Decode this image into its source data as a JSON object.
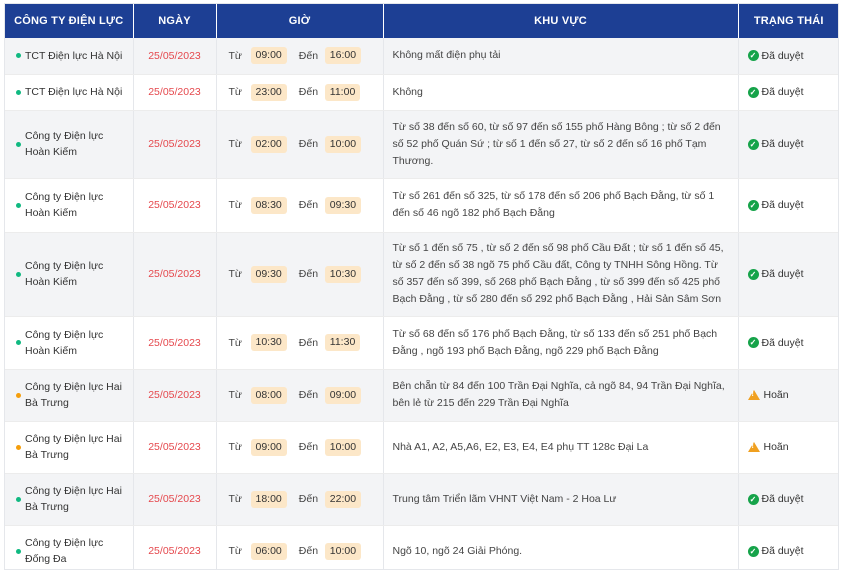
{
  "headers": [
    "CÔNG TY ĐIỆN LỰC",
    "NGÀY",
    "GIỜ",
    "KHU VỰC",
    "TRẠNG THÁI"
  ],
  "labels": {
    "from": "Từ",
    "to": "Đến"
  },
  "colors": {
    "header_bg": "#1d3f94",
    "date": "#e5484d",
    "dot_green": "#10b981",
    "dot_orange": "#f59e0b",
    "chip_bg": "#fce7c8"
  },
  "rows": [
    {
      "unit": "TCT Điện lực Hà Nội",
      "dot": "green",
      "date": "25/05/2023",
      "from": "09:00",
      "to": "16:00",
      "area": "Không mất điện phụ tải",
      "status": "Đã duyệt",
      "status_icon": "check-circle-icon",
      "h": 36
    },
    {
      "unit": "TCT Điện lực Hà Nội",
      "dot": "green",
      "date": "25/05/2023",
      "from": "23:00",
      "to": "11:00",
      "area": "Không",
      "status": "Đã duyệt",
      "status_icon": "check-circle-icon",
      "h": 36
    },
    {
      "unit": "Công ty Điện lực Hoàn Kiếm",
      "dot": "green",
      "date": "25/05/2023",
      "from": "02:00",
      "to": "10:00",
      "area": "Từ số 38 đến số 60, từ số 97 đến số 155 phố Hàng Bông ; từ số 2 đến số 52 phố Quán Sứ ; từ số 1 đến số 27, từ số 2 đến số 16 phố Tạm Thương.",
      "status": "Đã duyệt",
      "status_icon": "check-circle-icon",
      "h": 68
    },
    {
      "unit": "Công ty Điện lực Hoàn Kiếm",
      "dot": "green",
      "date": "25/05/2023",
      "from": "08:30",
      "to": "09:30",
      "area": "Từ số 261 đến số 325, từ số 178 đến số 206 phố Bạch Đằng, từ số 1 đến số 46 ngõ 182 phố Bạch Đằng",
      "status": "Đã duyệt",
      "status_icon": "check-circle-icon",
      "h": 54
    },
    {
      "unit": "Công ty Điện lực Hoàn Kiếm",
      "dot": "green",
      "date": "25/05/2023",
      "from": "09:30",
      "to": "10:30",
      "area": "Từ số 1 đến số 75 , từ số 2 đến số 98 phố Cầu Đất ; từ số 1 đến số 45, từ số 2 đến số 38 ngõ 75 phố Cầu đất, Công ty TNHH Sông Hồng. Từ số 357 đến số 399, số 268 phố Bạch Đằng , từ số 399 đến số 425 phố Bạch Đằng , từ số 280 đến số 292 phố Bạch Đằng , Hải Sản Sâm Sơn",
      "status": "Đã duyệt",
      "status_icon": "check-circle-icon",
      "h": 84
    },
    {
      "unit": "Công ty Điện lực Hoàn Kiếm",
      "dot": "green",
      "date": "25/05/2023",
      "from": "10:30",
      "to": "11:30",
      "area": "Từ số 68 đến số 176 phố Bạch Đằng, từ số 133 đến số 251 phố Bạch Đằng , ngõ 193 phố Bạch Đằng, ngõ 229 phố Bạch Đằng",
      "status": "Đã duyệt",
      "status_icon": "check-circle-icon",
      "h": 53
    },
    {
      "unit": "Công ty Điện lực Hai Bà Trưng",
      "dot": "orange",
      "date": "25/05/2023",
      "from": "08:00",
      "to": "09:00",
      "area": "Bên chẵn từ 84 đến 100 Trần Đại Nghĩa, cả ngõ 84, 94 Trần Đại Nghĩa, bên lẻ từ 215 đến 229 Trần Đại Nghĩa",
      "status": "Hoãn",
      "status_icon": "warning-icon",
      "h": 52
    },
    {
      "unit": "Công ty Điện lực Hai Bà Trưng",
      "dot": "orange",
      "date": "25/05/2023",
      "from": "09:00",
      "to": "10:00",
      "area": "Nhà A1, A2, A5,A6, E2, E3, E4, E4 phụ TT 128c Đại La",
      "status": "Hoãn",
      "status_icon": "warning-icon",
      "h": 52
    },
    {
      "unit": "Công ty Điện lực Hai Bà Trưng",
      "dot": "green",
      "date": "25/05/2023",
      "from": "18:00",
      "to": "22:00",
      "area": "Trung tâm Triển lãm VHNT Việt Nam - 2 Hoa Lư",
      "status": "Đã duyệt",
      "status_icon": "check-circle-icon",
      "h": 52
    },
    {
      "unit": "Công ty Điện lực Đống Đa",
      "dot": "green",
      "date": "25/05/2023",
      "from": "06:00",
      "to": "10:00",
      "area": "Ngõ 10, ngõ 24 Giải Phóng.",
      "status": "Đã duyệt",
      "status_icon": "check-circle-icon",
      "h": 52
    }
  ]
}
